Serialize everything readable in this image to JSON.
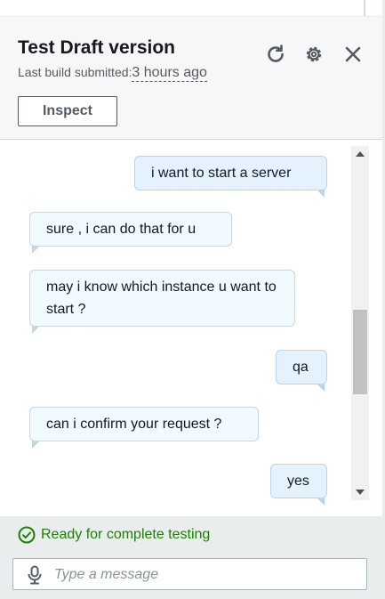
{
  "header": {
    "title": "Test Draft version",
    "build_label": "Last build submitted:",
    "build_time": "3 hours ago",
    "inspect_label": "Inspect",
    "icons": [
      "refresh-icon",
      "settings-icon",
      "close-icon"
    ]
  },
  "messages": [
    {
      "sender": "user",
      "text": "i want to start a server"
    },
    {
      "sender": "bot",
      "text": "sure , i can do that for u"
    },
    {
      "sender": "bot",
      "text": "may i know which instance u want to start ?"
    },
    {
      "sender": "user",
      "text": "qa"
    },
    {
      "sender": "bot",
      "text": "can i confirm your request ?"
    },
    {
      "sender": "user",
      "text": "yes"
    }
  ],
  "footer": {
    "status_text": "Ready for complete testing",
    "input_placeholder": "Type a message",
    "input_value": ""
  },
  "colors": {
    "status_green": "#1d8102",
    "bubble_bot": "#f1faff",
    "bubble_user": "#e3f2fc",
    "header_bg": "#f7f7f7",
    "footer_bg": "#eaeded"
  }
}
